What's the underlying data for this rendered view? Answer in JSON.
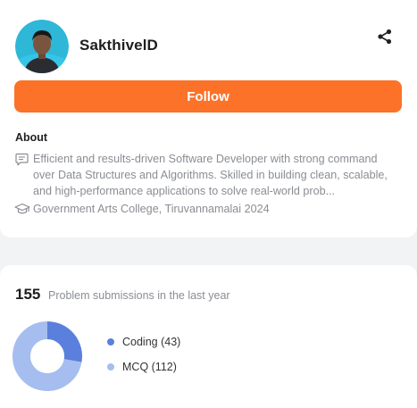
{
  "profile": {
    "username": "SakthivelD",
    "follow_label": "Follow",
    "about_heading": "About",
    "bio": "Efficient and results-driven Software Developer with strong command over Data Structures and Algorithms. Skilled in building clean, scalable, and high-performance applications to solve real-world prob...",
    "education": "Government Arts College, Tiruvannamalai 2024",
    "accent_color": "#fc7229"
  },
  "submissions": {
    "count": "155",
    "label": "Problem submissions in the last year"
  },
  "chart_data": {
    "type": "pie",
    "categories": [
      "Coding",
      "MCQ"
    ],
    "values": [
      43,
      112
    ],
    "legend_labels": [
      "Coding (43)",
      "MCQ (112)"
    ],
    "colors": [
      "#5b7fdc",
      "#a6bdf0"
    ],
    "donut": true,
    "legend_position": "right"
  },
  "icons": {
    "share": "share-icon",
    "bio": "message-icon",
    "education": "graduation-cap-icon",
    "avatar": "profile-photo"
  }
}
